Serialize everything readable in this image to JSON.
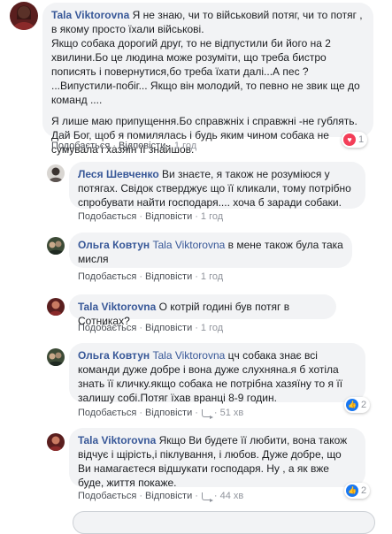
{
  "actions": {
    "like": "Подобається",
    "reply": "Відповісти",
    "dot": "·"
  },
  "comments": [
    {
      "author": "Tala Viktorovna",
      "paragraphs": [
        "Я не знаю, чи то військовий потяг, чи то потяг , в якому просто їхали військові.",
        "Якщо собака дорогий друг, то не відпустили би його на 2 хвилини.Бо це людина може розуміти, що треба бистро пописять і повернутися,бо треба їхати далі...А пес ? ...Випустили-побіг... Якщо він молодий, то певно не звик ще до команд ....",
        "Я лише маю припущення.Бо справжніх і справжні -не гублять. Дай Бог, щоб я помилялась і будь яким чином собака не сумувала і хазяїн її знайшов."
      ],
      "time": "1 год",
      "reaction_count": "1",
      "reaction_icon": "heart-icon"
    },
    {
      "author": "Леся Шевченко",
      "text": "Ви знаєте, я також не розуміюся у потягах. Свідок стверджує що її кликали, тому потрібно спробувати найти господаря.... хоча б заради собаки.",
      "time": "1 год"
    },
    {
      "author": "Ольга Ковтун",
      "mention": "Tala Viktorovna",
      "text": "в мене також була така мисля",
      "time": "1 год"
    },
    {
      "author": "Tala Viktorovna",
      "text": "О котрій годині був потяг в Сотниках?",
      "time": "1 год"
    },
    {
      "author": "Ольга Ковтун",
      "mention": "Tala Viktorovna",
      "text": "цч собака знає всі команди дуже добре і вона дуже слухняна.я б хотіла знать її кличку.якщо собака не потрібна хазяїну то я її залишу собі.Потяг їхав вранці 8-9 годин.",
      "time": "51 хв",
      "reaction_count": "2",
      "reaction_icon": "like-icon"
    },
    {
      "author": "Tala Viktorovna",
      "text": "Якщо Ви будете її любити, вона також відчує і щірість,і піклування, і любов. Дуже добре, що Ви намагаєтеся відшукати господаря. Ну , а як вже буде, життя покаже.",
      "time": "44 хв",
      "reaction_count": "2",
      "reaction_icon": "like-icon"
    }
  ],
  "colors": {
    "link": "#385898",
    "bubble": "#f2f3f5",
    "meta": "#90949c",
    "heart": "#f33e58",
    "like": "#1877f2"
  }
}
